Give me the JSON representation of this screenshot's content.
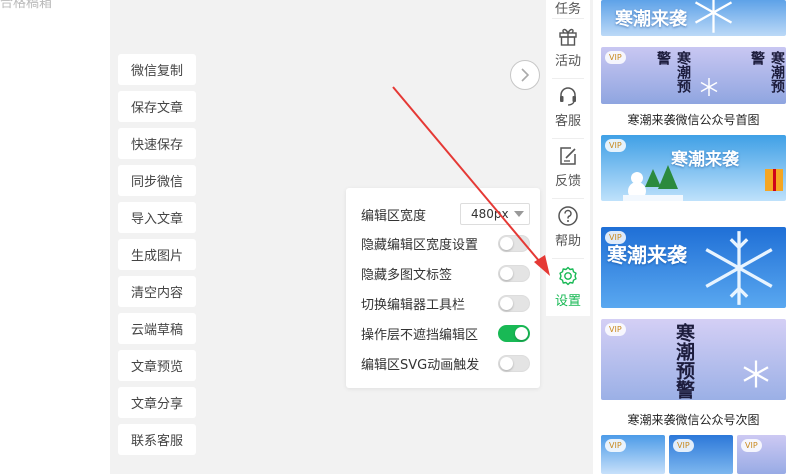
{
  "left_panel": {
    "top_text": "合格稿箱"
  },
  "actions": [
    "微信复制",
    "保存文章",
    "快速保存",
    "同步微信",
    "导入文章",
    "生成图片",
    "清空内容",
    "云端草稿",
    "文章预览",
    "文章分享",
    "联系客服"
  ],
  "toolbar": {
    "items": [
      {
        "label": "任务",
        "icon": "task-icon"
      },
      {
        "label": "活动",
        "icon": "gift-icon"
      },
      {
        "label": "客服",
        "icon": "headset-icon"
      },
      {
        "label": "反馈",
        "icon": "edit-icon"
      },
      {
        "label": "帮助",
        "icon": "help-icon"
      },
      {
        "label": "设置",
        "icon": "gear-icon"
      }
    ],
    "active_color": "#19b955"
  },
  "settings": {
    "width_label": "编辑区宽度",
    "width_value": "480px",
    "options": [
      {
        "label": "隐藏编辑区宽度设置",
        "on": false
      },
      {
        "label": "隐藏多图文标签",
        "on": false
      },
      {
        "label": "切换编辑器工具栏",
        "on": false
      },
      {
        "label": "操作层不遮挡编辑区",
        "on": true
      },
      {
        "label": "编辑区SVG动画触发",
        "on": false
      }
    ]
  },
  "templates": {
    "vip_badge": "VIP",
    "title_a": "寒潮来袭",
    "title_b": "寒潮预警",
    "caption_1": "寒潮来袭微信公众号首图",
    "caption_2": "寒潮来袭微信公众号次图"
  }
}
